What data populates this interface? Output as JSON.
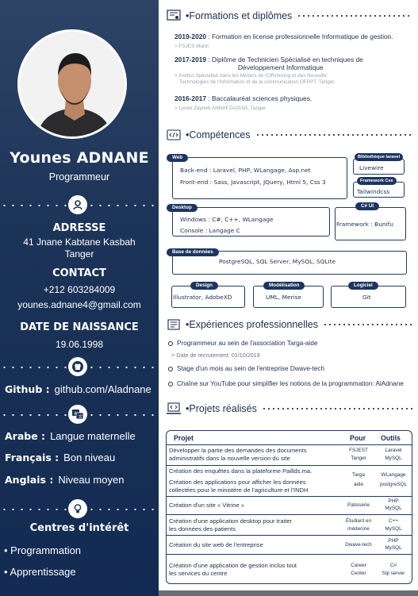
{
  "profile": {
    "name": "Younes ADNANE",
    "role": "Programmeur"
  },
  "address": {
    "title": "ADRESSE",
    "line1": "41 Jnane Kabtane Kasbah",
    "line2": "Tanger"
  },
  "contact": {
    "title": "CONTACT",
    "phone": "+212 603284009",
    "email": "younes.adnane4@gmail.com"
  },
  "birth": {
    "title": "DATE DE NAISSANCE",
    "date": "19.06.1998"
  },
  "github": {
    "label": "Github :",
    "value": "github.com/Aladnane"
  },
  "languages": [
    {
      "name": "Arabe :",
      "level": "Langue maternelle"
    },
    {
      "name": "Français :",
      "level": "Bon niveau"
    },
    {
      "name": "Anglais :",
      "level": "Niveau moyen"
    }
  ],
  "interests": {
    "title": "Centres d'intérêt",
    "items": [
      "Programmation",
      "Apprentissage"
    ]
  },
  "formations": {
    "title": "Formations et diplômes",
    "items": [
      {
        "years": "2019-2020",
        "text": ": Formation en license professionnelle Informatique de gestion.",
        "sub": "> FSJES Martil"
      },
      {
        "years": "2017-2019",
        "text": ": Diplôme de Technicien Spécialisé en techniques de",
        "text2": "Développement Informatique",
        "sub": "> Institut Spécialisé dans les Métiers de l'Offshoring et des Nouvelle",
        "sub2": "Technologies de l'Information et de la communication OFPPT, Tanger."
      },
      {
        "years": "2016-2017",
        "text": ": Baccalauréat sciences physiques.",
        "sub": "> Lycée Zayneb ANNAFZAOUIA, Tanger"
      }
    ]
  },
  "competences": {
    "title": "Compétences",
    "web": {
      "tag": "Web",
      "back": "Back-end :  Laravel, PHP, WLangage, Asp.net",
      "front": "Front-end : Sass, Javascript, JQuery, Html 5, Css 3"
    },
    "laravel_lib": {
      "tag": "Bibliothèque laravel",
      "value": "Livewire"
    },
    "css_framework": {
      "tag": "Framework Css",
      "value": "Tailwindcss"
    },
    "desktop": {
      "tag": "Desktop",
      "windows_label": "Windows :",
      "windows": "C#, C++, WLangage",
      "console_label": "Console :",
      "console": "Langage C"
    },
    "csharp_ui": {
      "tag": "C# UI",
      "label": "Framework :",
      "value": "Bunifu"
    },
    "databases": {
      "tag": "Base de données",
      "value": "PostgreSQL, SQL Server, MySQL, SQLite"
    },
    "design": {
      "tag": "Design",
      "value": "Illustrator, AdobeXD"
    },
    "modeling": {
      "tag": "Modélisation",
      "value": "UML,  Merise"
    },
    "software": {
      "tag": "Logiciel",
      "value": "Git"
    }
  },
  "experiences": {
    "title": "Expériences professionnelles",
    "items": [
      {
        "text": "Programmeur au sein de l'association Targa-aide",
        "sub": "> Date de recrutement: 01/10/2019"
      },
      {
        "text": "Stage d'un mois au sein de l'entreprise Dwave-tech"
      },
      {
        "text": "Chaîne sur YouTube pour simplifier les notions de la programmation: AlAdnane"
      }
    ]
  },
  "projects": {
    "title": "Projets réalisés",
    "headers": {
      "project": "Projet",
      "for": "Pour",
      "tools": "Outils"
    },
    "rows": [
      {
        "l1": "Développer la partie des demandes des documents",
        "l2": "administratifs dans la nouvelle version du site",
        "for1": "FSJEST",
        "for2": "Tanger",
        "t1": "Laravel",
        "t2": "MySQL"
      },
      {
        "l1": "Création des enquêtes dans la plateforme Paillds.ma.",
        "l2": "",
        "l3": "Création des applications pour afficher les données",
        "l4": "collectées pour le ministère de l'agriculture et l'INDH",
        "for1": "Targa",
        "for2": "aide",
        "t1": "WLangage",
        "t2": "postgreSQL"
      },
      {
        "l1": "Création d'un site « Vitrine »",
        "for1": "Patisserie",
        "t1": "PHP",
        "t2": "MySQL"
      },
      {
        "l1": "Création d'une application desktop pour traiter",
        "l2": "les données des patients",
        "for1": "Étudiant en",
        "for2": "médecine",
        "t1": "C++",
        "t2": "MySQL"
      },
      {
        "l1": "Création du site web de l'entreprise",
        "for1": "Dwave-tech",
        "t1": "PHP",
        "t2": "MySQL"
      },
      {
        "l1": "Création d'une application de gestion inclus tout",
        "l2": "les services du centre",
        "for1": "Career",
        "for2": "Center",
        "t1": "C#",
        "t2": "Sql server"
      }
    ]
  }
}
